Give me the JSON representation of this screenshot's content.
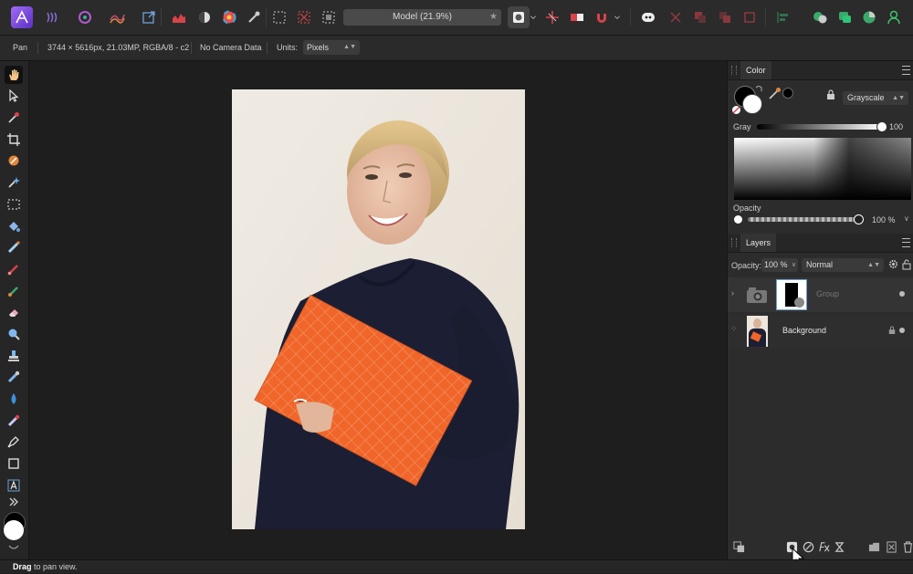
{
  "toolbar": {
    "document_name": "Model (21.9%)",
    "star": "★"
  },
  "context": {
    "tool": "Pan",
    "doc_info": "3744 × 5616px, 21.03MP, RGBA/8 - c2",
    "camera": "No Camera Data",
    "units_label": "Units:",
    "units_value": "Pixels"
  },
  "color_panel": {
    "tab": "Color",
    "mode": "Grayscale",
    "gray_label": "Gray",
    "gray_value": "100",
    "opacity_label": "Opacity",
    "opacity_value": "100 %",
    "gray_level": 1.0,
    "opacity_level": 1.0
  },
  "layers_panel": {
    "tab": "Layers",
    "opacity_label": "Opacity:",
    "opacity_value": "100 %",
    "blend_mode": "Normal",
    "layers": [
      {
        "name": "Group"
      },
      {
        "name": "Background"
      }
    ]
  },
  "status": {
    "bold": "Drag",
    "text": " to pan view."
  },
  "colors": {
    "accent_purple": "#7b4fd6",
    "orange": "#f0662a",
    "sweater": "#1c1f33"
  }
}
